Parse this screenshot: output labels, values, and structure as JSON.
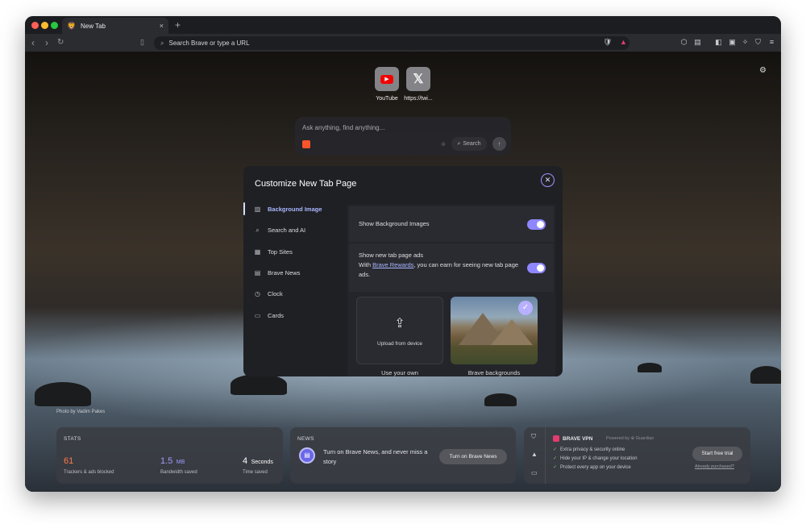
{
  "browser": {
    "tab_title": "New Tab",
    "new_tab_glyph": "+",
    "close_glyph": "×",
    "address_placeholder": "Search Brave or type a URL"
  },
  "top_sites": [
    {
      "label": "YouTube",
      "icon": "youtube-icon"
    },
    {
      "label": "https://twi...",
      "icon": "x-icon"
    }
  ],
  "search": {
    "placeholder": "Ask anything, find anything...",
    "button_label": "Search"
  },
  "customize": {
    "title": "Customize New Tab Page",
    "sidebar": [
      {
        "label": "Background Image",
        "icon": "image-icon",
        "active": true
      },
      {
        "label": "Search and AI",
        "icon": "search-icon"
      },
      {
        "label": "Top Sites",
        "icon": "top-sites-icon"
      },
      {
        "label": "Brave News",
        "icon": "news-icon"
      },
      {
        "label": "Clock",
        "icon": "clock-icon"
      },
      {
        "label": "Cards",
        "icon": "cards-icon"
      }
    ],
    "show_bg_label": "Show Background Images",
    "show_bg_on": true,
    "ads_title": "Show new tab page ads",
    "ads_desc_prefix": "With ",
    "ads_link": "Brave Rewards",
    "ads_desc_suffix": ", you can earn for seeing new tab page ads.",
    "ads_on": true,
    "upload_label": "Upload from device",
    "use_own_label": "Use your own",
    "brave_bg_label": "Brave backgrounds"
  },
  "photo_credit": "Photo by Vadim Pakes",
  "stats": {
    "title": "STATS",
    "items": [
      {
        "value": "61",
        "unit": "",
        "label": "Trackers & ads blocked",
        "color": "#ff7a4d"
      },
      {
        "value": "1.5",
        "unit": "MB",
        "label": "Bandwidth saved",
        "color": "#a09cff"
      },
      {
        "value": "4",
        "unit": "Seconds",
        "label": "Time saved",
        "color": "#ffffff"
      }
    ]
  },
  "news": {
    "title": "NEWS",
    "text": "Turn on Brave News, and never miss a story",
    "button": "Turn on Brave News"
  },
  "vpn": {
    "title": "BRAVE VPN",
    "powered_by": "Powered by ⊕ Guardian",
    "features": [
      "Extra privacy & security online",
      "Hide your IP & change your location",
      "Protect every app on your device"
    ],
    "button": "Start free trial",
    "link": "Already purchased?"
  }
}
